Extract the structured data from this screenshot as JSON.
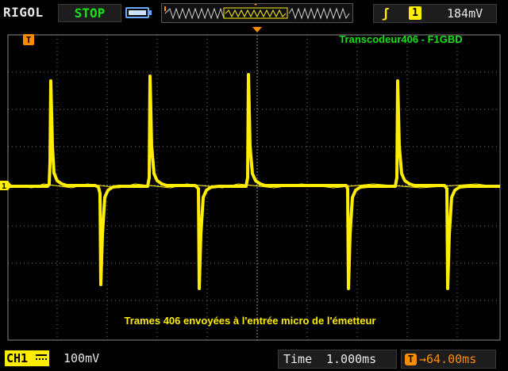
{
  "top": {
    "brand": "RIGOL",
    "run_state": "STOP",
    "trigger": {
      "edge_symbol": "ʃ",
      "source": "1",
      "level": "184mV"
    }
  },
  "screen": {
    "title_text": "Transcodeur406 - F1GBD",
    "caption_text": "Trames 406 envoyées à l'entrée micro de l'émetteur",
    "trigger_marker": "T",
    "channel_marker": "1"
  },
  "bottom": {
    "channel": "CH1",
    "volts_per_div": "100mV",
    "time_label": "Time",
    "time_per_div": "1.000ms",
    "trigger_offset": "→64.00ms"
  },
  "colors": {
    "trace": "#ffee00",
    "grid": "#7a7a7a",
    "title_text": "#19e119",
    "caption_text": "#ffee00",
    "offset": "#ff8c00"
  }
}
